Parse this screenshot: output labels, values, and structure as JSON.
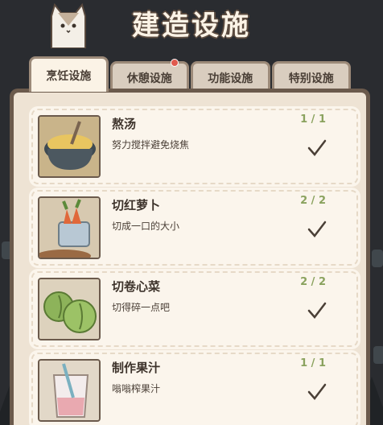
{
  "title": "建造设施",
  "tabs": [
    {
      "label": "烹饪设施",
      "active": true,
      "badge": false
    },
    {
      "label": "休憩设施",
      "active": false,
      "badge": true
    },
    {
      "label": "功能设施",
      "active": false,
      "badge": false
    },
    {
      "label": "特别设施",
      "active": false,
      "badge": false
    }
  ],
  "items": [
    {
      "name": "熬汤",
      "desc": "努力搅拌避免烧焦",
      "count": "1 / 1",
      "image": "soup-pot-icon"
    },
    {
      "name": "切红萝卜",
      "desc": "切成一口的大小",
      "count": "2 / 2",
      "image": "carrot-bucket-icon"
    },
    {
      "name": "切卷心菜",
      "desc": "切得碎一点吧",
      "count": "2 / 2",
      "image": "cabbage-icon"
    },
    {
      "name": "制作果汁",
      "desc": "嗡嗡榨果汁",
      "count": "1 / 1",
      "image": "juice-glass-icon"
    }
  ],
  "colors": {
    "accent_green": "#8aa25e",
    "badge_red": "#e05a4e",
    "panel_brown": "#6b5a4c"
  }
}
